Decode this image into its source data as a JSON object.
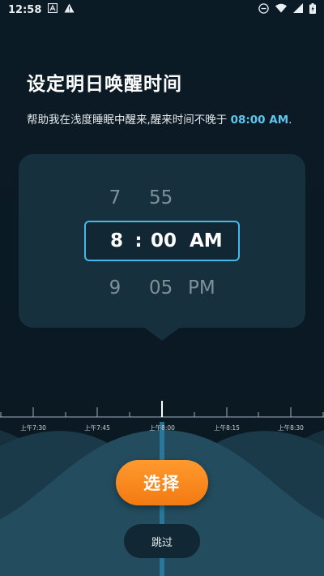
{
  "status_bar": {
    "time": "12:58",
    "notification_icons": [
      "a-box-icon",
      "warning-icon"
    ],
    "system_icons": [
      "dnd-icon",
      "wifi-icon",
      "signal-icon",
      "battery-icon"
    ]
  },
  "header": {
    "title": "设定明日唤醒时间",
    "subtitle_prefix": "帮助我在浅度睡眠中醒来,醒来时间不晚于 ",
    "subtitle_time": "08:00 AM",
    "subtitle_suffix": "."
  },
  "picker": {
    "above": {
      "hour": "7",
      "minute": "55",
      "ampm": ""
    },
    "selected": {
      "hour": "8",
      "separator": ":",
      "minute": "00",
      "ampm": "AM"
    },
    "below": {
      "hour": "9",
      "minute": "05",
      "ampm": "PM"
    }
  },
  "timeline": {
    "labels": [
      "上午7:30",
      "上午7:45",
      "上午8:00",
      "上午8:15",
      "上午8:30"
    ]
  },
  "actions": {
    "select_label": "选择",
    "skip_label": "跳过"
  },
  "colors": {
    "accent": "#44b9ea",
    "button_orange": "#f58a1f",
    "background": "#0b1b26",
    "card": "#16303d"
  }
}
